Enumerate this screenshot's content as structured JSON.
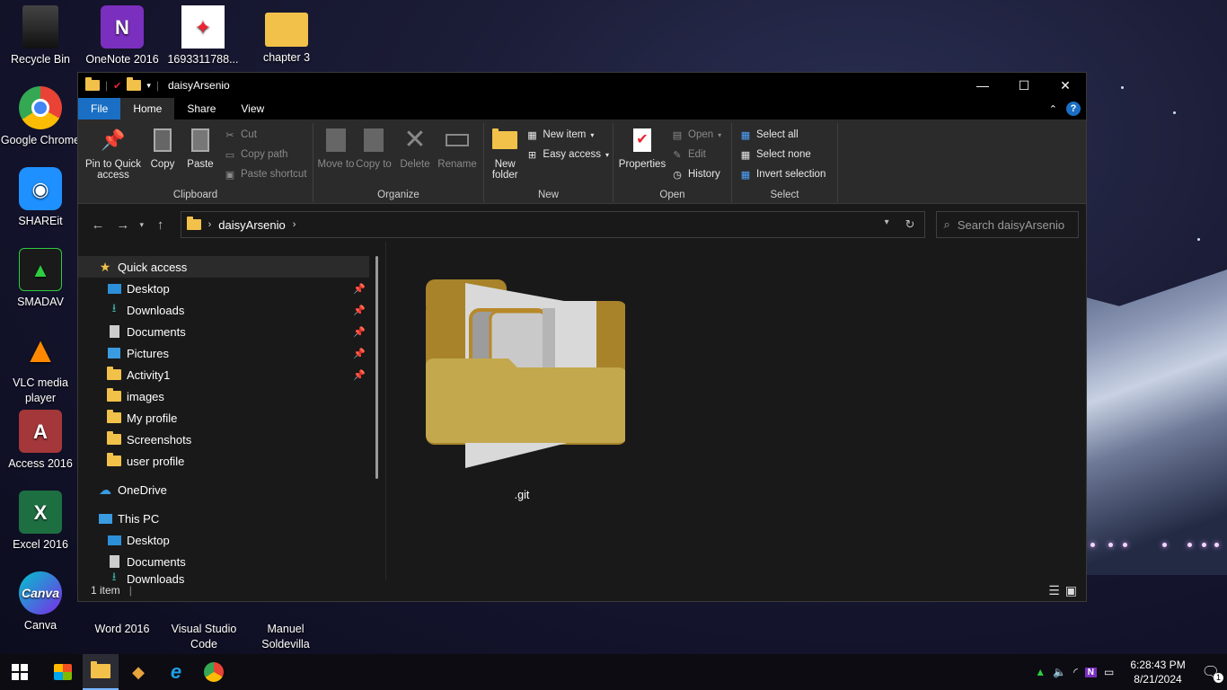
{
  "desktop": {
    "icons": [
      {
        "label": "Recycle Bin"
      },
      {
        "label": "OneNote 2016"
      },
      {
        "label": "1693311788..."
      },
      {
        "label": "chapter 3"
      },
      {
        "label": "Google Chrome"
      },
      {
        "label": "SHAREit"
      },
      {
        "label": "SMADAV"
      },
      {
        "label": "VLC media player"
      },
      {
        "label": "Access 2016"
      },
      {
        "label": "Excel 2016"
      },
      {
        "label": "Canva"
      },
      {
        "label": "Word 2016"
      },
      {
        "label": "Visual Studio Code"
      },
      {
        "label": "Manuel Soldevilla"
      }
    ]
  },
  "window": {
    "title": "daisyArsenio",
    "tabs": [
      "File",
      "Home",
      "Share",
      "View"
    ],
    "ribbon": {
      "clipboard": {
        "label": "Clipboard",
        "pin": "Pin to Quick access",
        "copy": "Copy",
        "paste": "Paste",
        "cut": "Cut",
        "copy_path": "Copy path",
        "paste_shortcut": "Paste shortcut"
      },
      "organize": {
        "label": "Organize",
        "move_to": "Move to",
        "copy_to": "Copy to",
        "delete": "Delete",
        "rename": "Rename"
      },
      "new": {
        "label": "New",
        "new_folder": "New folder",
        "new_item": "New item",
        "easy_access": "Easy access"
      },
      "open": {
        "label": "Open",
        "properties": "Properties",
        "open": "Open",
        "edit": "Edit",
        "history": "History"
      },
      "select": {
        "label": "Select",
        "select_all": "Select all",
        "select_none": "Select none",
        "invert": "Invert selection"
      }
    },
    "address": {
      "path": "daisyArsenio",
      "search_placeholder": "Search daisyArsenio"
    },
    "nav": {
      "quick_access": "Quick access",
      "quick_items": [
        "Desktop",
        "Downloads",
        "Documents",
        "Pictures",
        "Activity1",
        "images",
        "My profile",
        "Screenshots",
        "user profile"
      ],
      "onedrive": "OneDrive",
      "this_pc": "This PC",
      "pc_items": [
        "Desktop",
        "Documents",
        "Downloads"
      ]
    },
    "files": [
      {
        "name": ".git"
      }
    ],
    "status": {
      "count": "1 item"
    }
  },
  "taskbar": {
    "time": "6:28:43 PM",
    "date": "8/21/2024",
    "notification_count": "1"
  },
  "colors": {
    "accent": "#1a6fc4",
    "folder": "#f1c14a",
    "window_bg": "#191919",
    "ribbon_bg": "#2b2b2b"
  }
}
